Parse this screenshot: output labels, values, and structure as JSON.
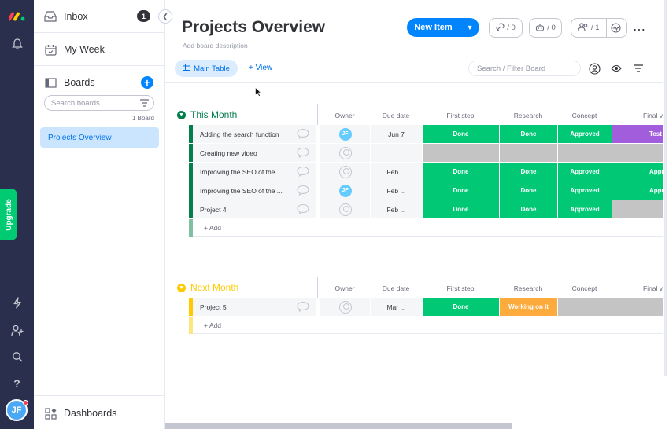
{
  "rail": {
    "upgrade_label": "Upgrade",
    "avatar_initials": "JF",
    "icons": [
      "bell-icon",
      "lightning-icon",
      "add-user-icon",
      "search-icon",
      "help-icon"
    ]
  },
  "sidebar": {
    "inbox_label": "Inbox",
    "inbox_count": "1",
    "my_week_label": "My Week",
    "boards_label": "Boards",
    "search_placeholder": "Search boards...",
    "board_count": "1 Board",
    "board_item": "Projects Overview",
    "dashboards_label": "Dashboards"
  },
  "header": {
    "title": "Projects Overview",
    "description": "Add board description",
    "new_item_label": "New Item",
    "integrations_count": "/ 0",
    "automations_count": "/ 0",
    "members_count": "/ 1",
    "main_table_tab": "Main Table",
    "add_view_label": "+ View",
    "search_placeholder": "Search / Filter Board"
  },
  "columns": [
    "Owner",
    "Due date",
    "First step",
    "Research",
    "Concept",
    "Final ve"
  ],
  "colors": {
    "done": "#00c875",
    "working": "#fdab3d",
    "purple": "#a25ddc",
    "empty": "#c4c4c4",
    "green_group": "#037f4c",
    "orange_group": "#ffcb00"
  },
  "groups": [
    {
      "title": "This Month",
      "color": "#037f4c",
      "add_label": "+ Add",
      "rows": [
        {
          "name": "Adding the search function",
          "owner": "JF",
          "due": "Jun 7",
          "first": "Done",
          "research": "Done",
          "concept": "Approved",
          "final": "Test"
        },
        {
          "name": "Creating new video",
          "owner": "",
          "due": "",
          "first": "",
          "research": "",
          "concept": "",
          "final": ""
        },
        {
          "name": "Improving the SEO of the ...",
          "owner": "",
          "due": "Feb ...",
          "first": "Done",
          "research": "Done",
          "concept": "Approved",
          "final": "Appro"
        },
        {
          "name": "Improving the SEO of the ...",
          "owner": "JF",
          "due": "Feb ...",
          "first": "Done",
          "research": "Done",
          "concept": "Approved",
          "final": "Appro"
        },
        {
          "name": "Project 4",
          "owner": "",
          "due": "Feb ...",
          "first": "Done",
          "research": "Done",
          "concept": "Approved",
          "final": ""
        }
      ]
    },
    {
      "title": "Next Month",
      "color": "#ffcb00",
      "add_label": "+ Add",
      "rows": [
        {
          "name": "Project 5",
          "owner": "",
          "due": "Mar ...",
          "first": "Done",
          "research": "Working on it",
          "concept": "",
          "final": ""
        }
      ]
    }
  ]
}
